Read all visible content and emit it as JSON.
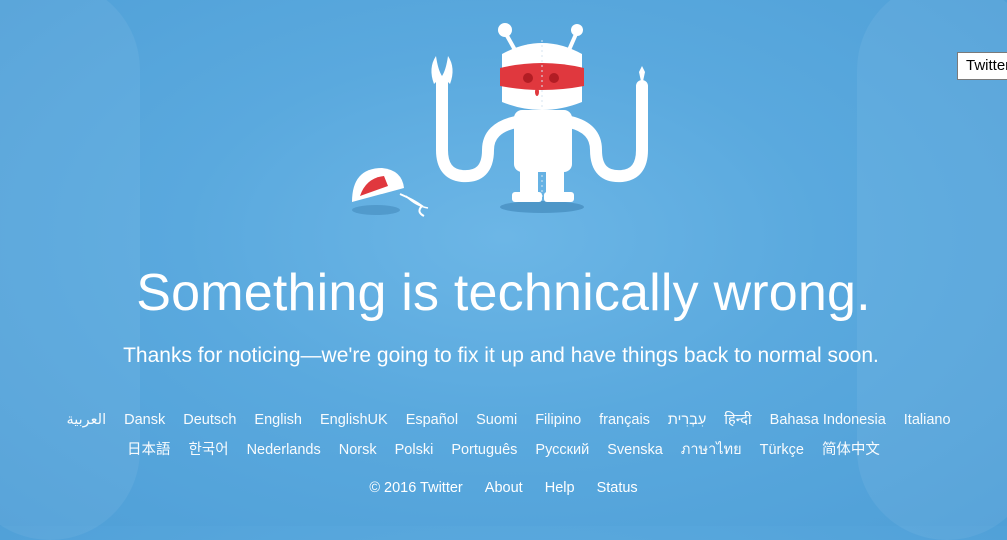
{
  "tooltip": {
    "text": "Twitter"
  },
  "error": {
    "headline": "Something is technically wrong.",
    "subline": "Thanks for noticing—we're going to fix it up and have things back to normal soon."
  },
  "languages": {
    "row1": [
      "العربية",
      "Dansk",
      "Deutsch",
      "English",
      "EnglishUK",
      "Español",
      "Suomi",
      "Filipino",
      "français",
      "עִבְרִית",
      "हिन्दी",
      "Bahasa Indonesia",
      "Italiano"
    ],
    "row2": [
      "日本語",
      "한국어",
      "Nederlands",
      "Norsk",
      "Polski",
      "Português",
      "Русский",
      "Svenska",
      "ภาษาไทย",
      "Türkçe",
      "简体中文"
    ]
  },
  "footer": {
    "copyright": "© 2016 Twitter",
    "about": "About",
    "help": "Help",
    "status": "Status"
  },
  "colors": {
    "background": "#5aa9de",
    "robot_white": "#ffffff",
    "mask_red": "#e0383e",
    "text": "#ffffff"
  },
  "icons": {
    "illustration": "broken-robot-illustration"
  }
}
